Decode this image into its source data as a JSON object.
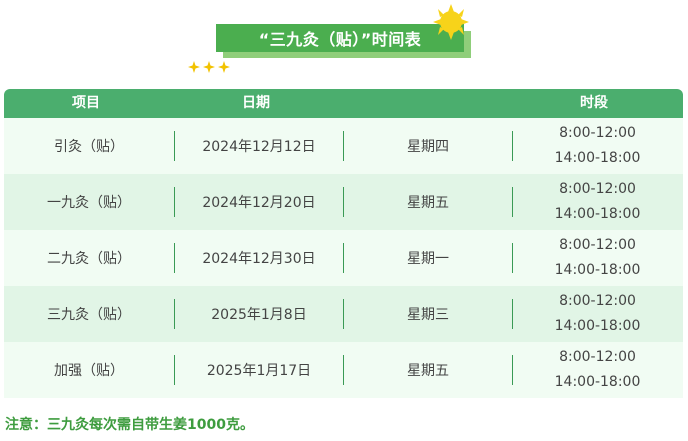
{
  "title": "“三九灸（贴）”时间表",
  "header": {
    "item": "项目",
    "date": "日期",
    "time": "时段"
  },
  "rows": [
    {
      "item": "引灸（贴）",
      "date": "2024年12月12日",
      "weekday": "星期四",
      "time1": "8:00-12:00",
      "time2": "14:00-18:00"
    },
    {
      "item": "一九灸（贴）",
      "date": "2024年12月20日",
      "weekday": "星期五",
      "time1": "8:00-12:00",
      "time2": "14:00-18:00"
    },
    {
      "item": "二九灸（贴）",
      "date": "2024年12月30日",
      "weekday": "星期一",
      "time1": "8:00-12:00",
      "time2": "14:00-18:00"
    },
    {
      "item": "三九灸（贴）",
      "date": "2025年1月8日",
      "weekday": "星期三",
      "time1": "8:00-12:00",
      "time2": "14:00-18:00"
    },
    {
      "item": "加强（贴）",
      "date": "2025年1月17日",
      "weekday": "星期五",
      "time1": "8:00-12:00",
      "time2": "14:00-18:00"
    }
  ],
  "note": "注意：三九灸每次需自带生姜1000克。",
  "colors": {
    "banner": "#4bae4f",
    "header": "#4bae6e",
    "row_light": "#f1fcf3",
    "row_dark": "#e1f5e6",
    "note": "#3e9c3f",
    "sun": "#f7d31a"
  },
  "icons": {
    "decoration": "sun-icon",
    "sparkles": "sparkle-icon"
  }
}
